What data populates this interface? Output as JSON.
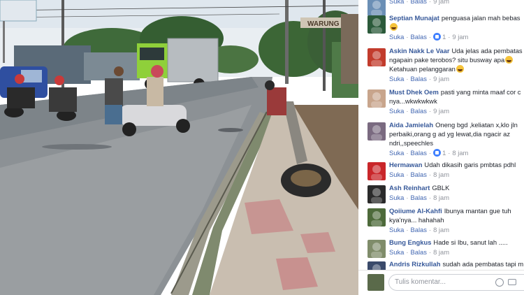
{
  "photo": {
    "shop_sign": "WARUNG"
  },
  "comments": [
    {
      "author": "",
      "text": "",
      "actions": {
        "like": "Suka",
        "reply": "Balas",
        "time": "9 jam"
      },
      "avatar_color": "#6b8fb5"
    },
    {
      "author": "Septian Munajat",
      "text": "penguasa jalan mah bebas",
      "emoji": true,
      "actions": {
        "like": "Suka",
        "reply": "Balas",
        "likes": "1",
        "time": "9 jam"
      },
      "avatar_color": "#2b5a3a"
    },
    {
      "author": "Askin Nakk Le Vaar",
      "text": "Uda jelas ada pembatas",
      "text2": "ngapain pake terobos? situ busway apa",
      "emoji2": true,
      "text3": "Ketahuan pelanggaran",
      "emoji3": true,
      "actions": {
        "like": "Suka",
        "reply": "Balas",
        "time": "9 jam"
      },
      "avatar_color": "#c23b2c"
    },
    {
      "author": "Must Dhek Oem",
      "text": "pasti yang minta maaf cor c",
      "text2": "nya...wkwkwkwk",
      "actions": {
        "like": "Suka",
        "reply": "Balas",
        "time": "9 jam"
      },
      "avatar_color": "#c8a58c"
    },
    {
      "author": "Aida Jamielah",
      "text": "Oneng bgd ,keliatan x,klo jln",
      "text2": "perbaiki,orang g ad yg lewat,dia ngacir az",
      "text3": "ndri,,speechles",
      "actions": {
        "like": "Suka",
        "reply": "Balas",
        "likes": "1",
        "time": "8 jam"
      },
      "avatar_color": "#7a6a80"
    },
    {
      "author": "Hermawan",
      "text": "Udah dikasih garis pmbtas pdhl",
      "actions": {
        "like": "Suka",
        "reply": "Balas",
        "time": "8 jam"
      },
      "avatar_color": "#c9262a"
    },
    {
      "author": "Ash Reinhart",
      "text": "GBLK",
      "actions": {
        "like": "Suka",
        "reply": "Balas",
        "time": "8 jam"
      },
      "avatar_color": "#2a2a2a"
    },
    {
      "author": "Qoiiume Al-Kahfi",
      "text": "Ibunya mantan gue tuh",
      "text2": "kya'nya... hahahah",
      "actions": {
        "like": "Suka",
        "reply": "Balas",
        "time": "8 jam"
      },
      "avatar_color": "#4d6a3a"
    },
    {
      "author": "Bung Engkus",
      "text": "Hade si Ibu, sanut lah .....",
      "actions": {
        "like": "Suka",
        "reply": "Balas",
        "time": "8 jam"
      },
      "avatar_color": "#7f8c6a"
    },
    {
      "author": "Andris Rizkullah",
      "text": "sudah ada pembatas tapi m",
      "actions": {
        "like": "",
        "reply": "",
        "time": ""
      },
      "avatar_color": "#3a4a6a"
    }
  ],
  "reply_box": {
    "placeholder": "Tulis komentar...",
    "avatar_color": "#5a6a4a"
  }
}
